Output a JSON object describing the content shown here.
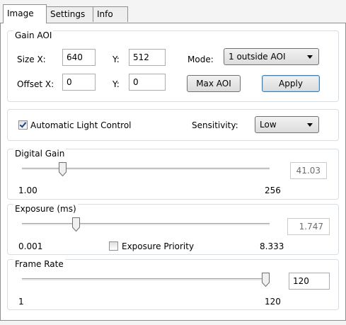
{
  "tabs": [
    "Image",
    "Settings",
    "Info"
  ],
  "gain_aoi": {
    "title": "Gain AOI",
    "size_x_label": "Size X:",
    "size_x_value": "640",
    "size_y_label": "Y:",
    "size_y_value": "512",
    "mode_label": "Mode:",
    "mode_value": "1 outside AOI",
    "offset_x_label": "Offset X:",
    "offset_x_value": "0",
    "offset_y_label": "Y:",
    "offset_y_value": "0",
    "max_aoi_label": "Max AOI",
    "apply_label": "Apply"
  },
  "light_control": {
    "checkbox_label": "Automatic Light Control",
    "checked": true,
    "sensitivity_label": "Sensitivity:",
    "sensitivity_value": "Low"
  },
  "digital_gain": {
    "title": "Digital Gain",
    "value": "41.03",
    "min": "1.00",
    "max": "256",
    "slider_fraction": 0.153
  },
  "exposure": {
    "title": "Exposure (ms)",
    "value": "1.747",
    "min": "0.001",
    "max": "8.333",
    "slider_fraction": 0.209,
    "priority_label": "Exposure Priority",
    "priority_checked": false
  },
  "frame_rate": {
    "title": "Frame Rate",
    "value": "120",
    "min": "1",
    "max": "120",
    "slider_fraction": 1.0
  },
  "colors": {
    "group_border": "#d5dfe5",
    "tab_border": "#8e8f8f",
    "focus_border": "#3c7fb1"
  }
}
